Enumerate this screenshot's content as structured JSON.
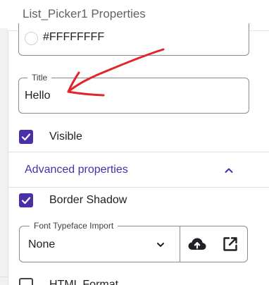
{
  "panel": {
    "title": "List_Picker1 Properties"
  },
  "background_color": {
    "value": "#FFFFFFFF"
  },
  "title_field": {
    "label": "Title",
    "value": "Hello"
  },
  "visible": {
    "label": "Visible",
    "checked": true
  },
  "advanced": {
    "heading": "Advanced properties",
    "expanded": true
  },
  "border_shadow": {
    "label": "Border Shadow",
    "checked": true
  },
  "font_typeface": {
    "label": "Font Typeface Import",
    "value": "None"
  },
  "html_format": {
    "label": "HTML Format",
    "checked": false
  },
  "colors": {
    "accent": "#4a2fa8",
    "annotation_arrow": "#e0262b"
  }
}
